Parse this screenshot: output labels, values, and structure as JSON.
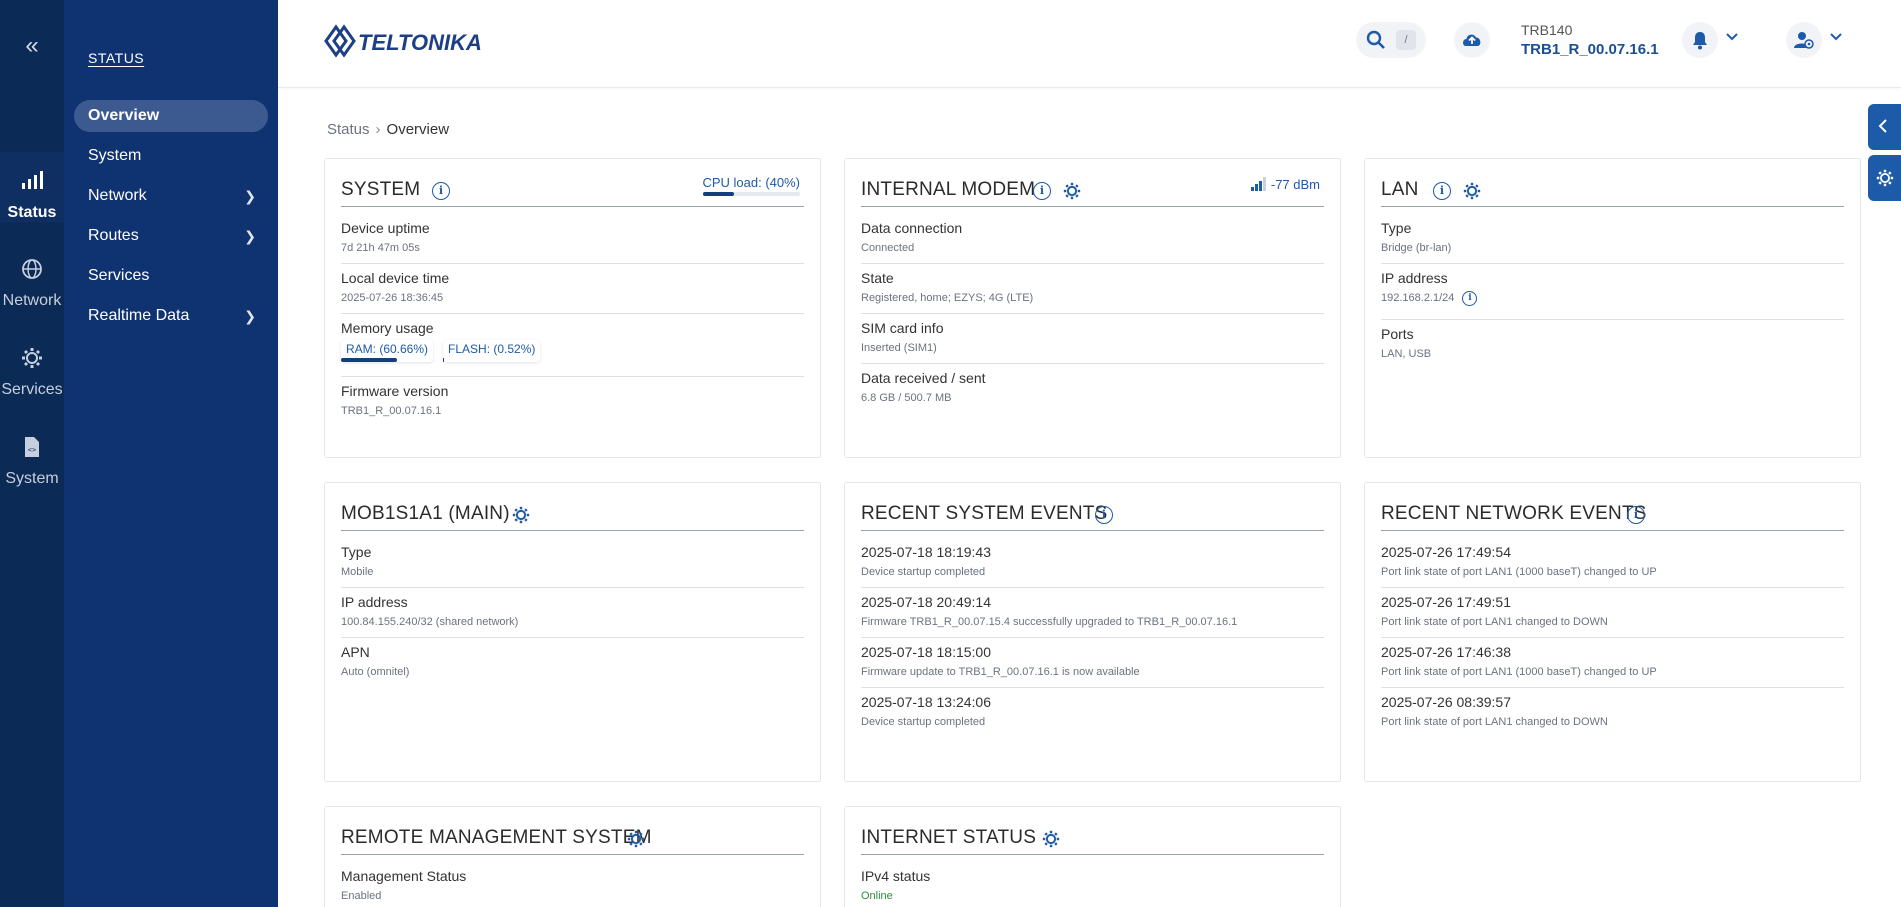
{
  "rail": {
    "collapse_icon": "double-chevron-left-icon",
    "items": [
      {
        "label": "Status",
        "icon": "signal-bars-icon",
        "active": true
      },
      {
        "label": "Network",
        "icon": "globe-icon",
        "active": false
      },
      {
        "label": "Services",
        "icon": "gear-icon",
        "active": false
      },
      {
        "label": "System",
        "icon": "file-code-icon",
        "active": false
      }
    ]
  },
  "sidebar": {
    "title": "STATUS",
    "items": [
      {
        "label": "Overview",
        "active": true,
        "has_children": false
      },
      {
        "label": "System",
        "active": false,
        "has_children": false
      },
      {
        "label": "Network",
        "active": false,
        "has_children": true
      },
      {
        "label": "Routes",
        "active": false,
        "has_children": true
      },
      {
        "label": "Services",
        "active": false,
        "has_children": false
      },
      {
        "label": "Realtime Data",
        "active": false,
        "has_children": true
      }
    ]
  },
  "header": {
    "logo_text": "TELTONIKA",
    "search_shortcut": "/",
    "device_model": "TRB140",
    "device_firmware": "TRB1_R_00.07.16.1"
  },
  "breadcrumb": {
    "parent": "Status",
    "current": "Overview"
  },
  "cards": {
    "system": {
      "title": "SYSTEM",
      "cpu_label": "CPU load: (40%)",
      "cpu_fraction": 0.4,
      "uptime_label": "Device uptime",
      "uptime_value": "7d 21h 47m 05s",
      "time_label": "Local device time",
      "time_value": "2025-07-26 18:36:45",
      "memory_label": "Memory usage",
      "ram_label": "RAM: (60.66%)",
      "ram_fraction": 0.6066,
      "flash_label": "FLASH: (0.52%)",
      "flash_fraction": 0.0052,
      "fw_label": "Firmware version",
      "fw_value": "TRB1_R_00.07.16.1"
    },
    "modem": {
      "title": "INTERNAL MODEM",
      "signal": "-77 dBm",
      "rows": [
        {
          "label": "Data connection",
          "value": "Connected"
        },
        {
          "label": "State",
          "value": "Registered, home; EZYS; 4G (LTE)"
        },
        {
          "label": "SIM card info",
          "value": "Inserted (SIM1)"
        },
        {
          "label": "Data received / sent",
          "value": "6.8 GB / 500.7 MB"
        }
      ]
    },
    "lan": {
      "title": "LAN",
      "type_label": "Type",
      "type_value": "Bridge (br-lan)",
      "ip_label": "IP address",
      "ip_value": "192.168.2.1/24",
      "ports_label": "Ports",
      "ports_value": "LAN, USB"
    },
    "mob": {
      "title": "MOB1S1A1 (MAIN)",
      "rows": [
        {
          "label": "Type",
          "value": "Mobile"
        },
        {
          "label": "IP address",
          "value": "100.84.155.240/32 (shared network)"
        },
        {
          "label": "APN",
          "value": "Auto (omnitel)"
        }
      ]
    },
    "sys_events": {
      "title": "RECENT SYSTEM EVENTS",
      "rows": [
        {
          "label": "2025-07-18 18:19:43",
          "value": "Device startup completed"
        },
        {
          "label": "2025-07-18 20:49:14",
          "value": "Firmware TRB1_R_00.07.15.4 successfully upgraded to TRB1_R_00.07.16.1"
        },
        {
          "label": "2025-07-18 18:15:00",
          "value": "Firmware update to TRB1_R_00.07.16.1 is now available"
        },
        {
          "label": "2025-07-18 13:24:06",
          "value": "Device startup completed"
        }
      ]
    },
    "net_events": {
      "title": "RECENT NETWORK EVENTS",
      "rows": [
        {
          "label": "2025-07-26 17:49:54",
          "value": "Port link state of port LAN1 (1000 baseT) changed to UP"
        },
        {
          "label": "2025-07-26 17:49:51",
          "value": "Port link state of port LAN1 changed to DOWN"
        },
        {
          "label": "2025-07-26 17:46:38",
          "value": "Port link state of port LAN1 (1000 baseT) changed to UP"
        },
        {
          "label": "2025-07-26 08:39:57",
          "value": "Port link state of port LAN1 changed to DOWN"
        }
      ]
    },
    "rms": {
      "title": "REMOTE MANAGEMENT SYSTEM",
      "rows": [
        {
          "label": "Management Status",
          "value": "Enabled"
        }
      ]
    },
    "internet": {
      "title": "INTERNET STATUS",
      "rows": [
        {
          "label": "IPv4 status",
          "value": "Online"
        }
      ]
    }
  },
  "colors": {
    "rail_bg": "#0b2a55",
    "sidebar_bg": "#0f3270",
    "accent": "#1d5aa8",
    "online": "#2e8b3d"
  }
}
